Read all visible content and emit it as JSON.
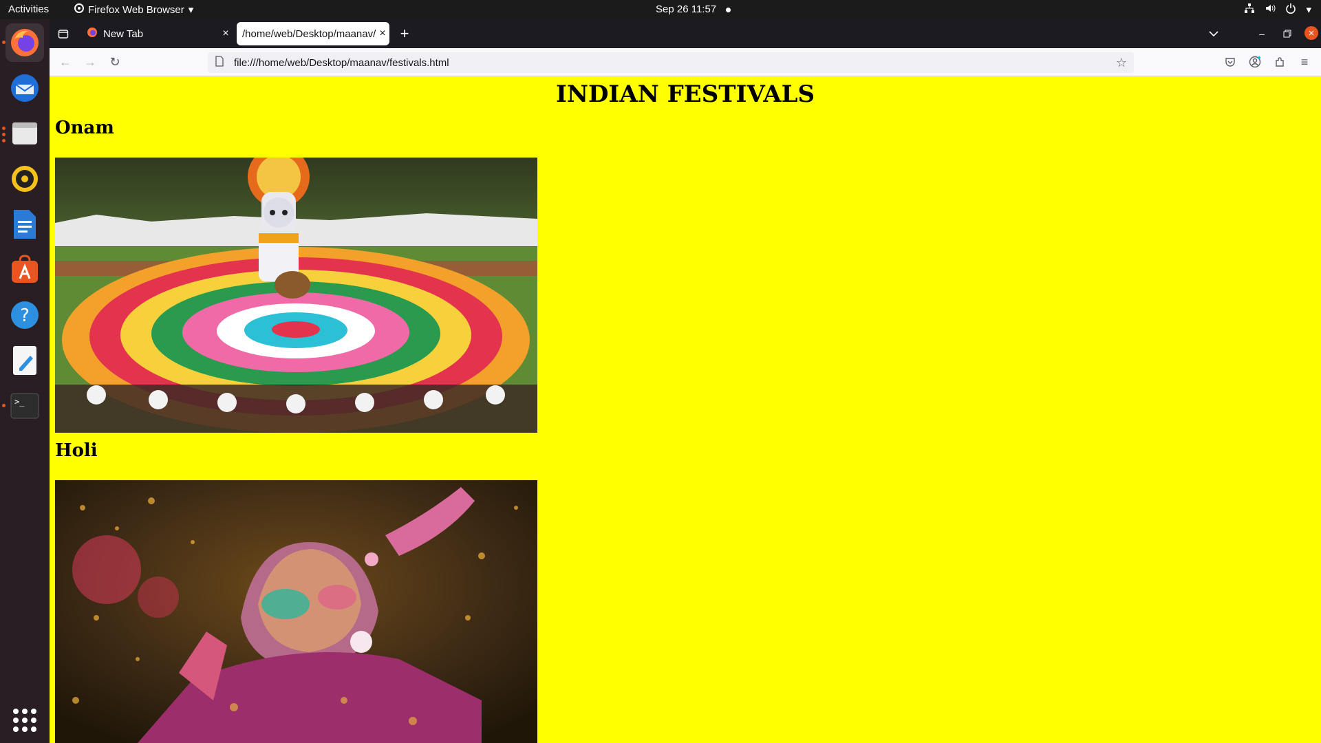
{
  "topbar": {
    "activities": "Activities",
    "app_name": "Firefox Web Browser",
    "clock": "Sep 26  11:57"
  },
  "dock": {
    "items": [
      "firefox-icon",
      "thunderbird-icon",
      "files-icon",
      "rhythmbox-icon",
      "writer-icon",
      "app-center-icon",
      "help-icon",
      "text-editor-icon",
      "terminal-icon"
    ]
  },
  "browser": {
    "tabs": [
      {
        "label": "New Tab"
      },
      {
        "label": "/home/web/Desktop/maanav/festivals.html"
      }
    ],
    "url": "file:///home/web/Desktop/maanav/festivals.html"
  },
  "page": {
    "title": "INDIAN FESTIVALS",
    "festivals": [
      {
        "name": "Onam"
      },
      {
        "name": "Holi"
      }
    ]
  }
}
